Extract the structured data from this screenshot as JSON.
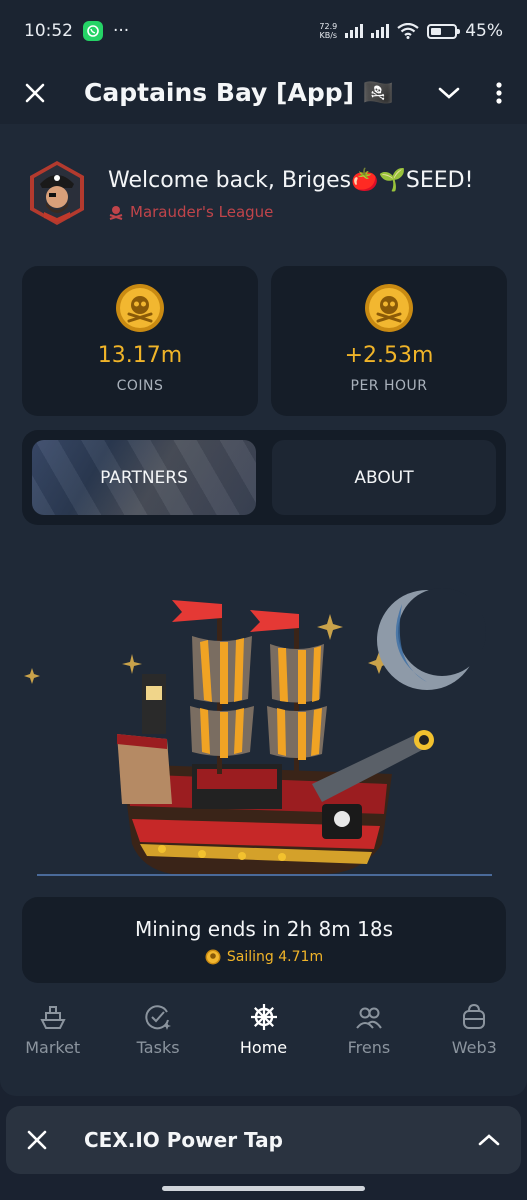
{
  "status_bar": {
    "time": "10:52",
    "notification_dots": "···",
    "net_speed_value": "72.9",
    "net_speed_unit": "KB/s",
    "battery": "45%"
  },
  "header": {
    "title": "Captains Bay [App] 🏴‍☠️"
  },
  "profile": {
    "welcome": "Welcome back, Briges🍅🌱SEED!",
    "league": "Marauder's League"
  },
  "stats": [
    {
      "value": "13.17m",
      "label": "COINS"
    },
    {
      "value": "+2.53m",
      "label": "PER HOUR"
    }
  ],
  "buttons": {
    "partners": "PARTNERS",
    "about": "ABOUT"
  },
  "mining": {
    "text": "Mining ends in 2h 8m 18s",
    "sailing": "Sailing 4.71m"
  },
  "tabs": [
    {
      "label": "Market"
    },
    {
      "label": "Tasks"
    },
    {
      "label": "Home"
    },
    {
      "label": "Frens"
    },
    {
      "label": "Web3"
    }
  ],
  "mini_app": {
    "title": "CEX.IO Power Tap"
  },
  "colors": {
    "accent_gold": "#f0b429",
    "league_red": "#c0444a",
    "background": "#1f2937"
  }
}
